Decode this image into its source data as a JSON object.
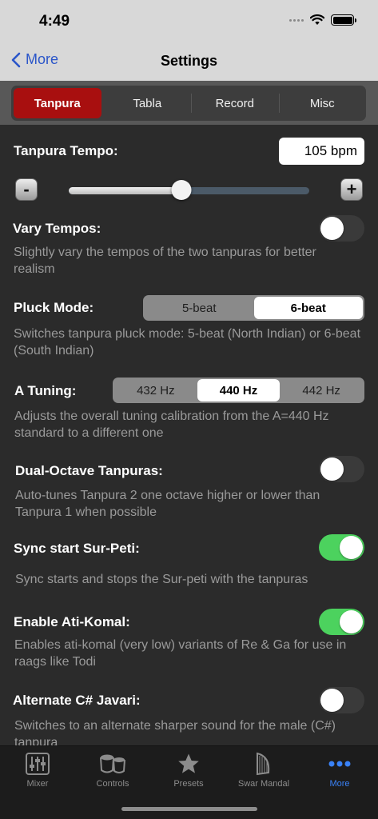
{
  "status": {
    "time": "4:49"
  },
  "nav": {
    "back_label": "More",
    "title": "Settings"
  },
  "tabs": [
    {
      "label": "Tanpura",
      "active": true
    },
    {
      "label": "Tabla",
      "active": false
    },
    {
      "label": "Record",
      "active": false
    },
    {
      "label": "Misc",
      "active": false
    }
  ],
  "tempo": {
    "label": "Tanpura Tempo:",
    "value": "105 bpm",
    "minus": "-",
    "plus": "+",
    "slider_fraction": 0.47
  },
  "vary_tempos": {
    "label": "Vary Tempos:",
    "on": false,
    "desc": "Slightly vary the tempos of the two tanpuras for better realism"
  },
  "pluck_mode": {
    "label": "Pluck Mode:",
    "options": [
      "5-beat",
      "6-beat"
    ],
    "selected": "6-beat",
    "desc": "Switches tanpura pluck mode: 5-beat (North Indian) or 6-beat (South Indian)"
  },
  "a_tuning": {
    "label": "A Tuning:",
    "options": [
      "432 Hz",
      "440 Hz",
      "442 Hz"
    ],
    "selected": "440 Hz",
    "desc": "Adjusts the overall tuning calibration from the A=440 Hz standard to a different one"
  },
  "dual_octave": {
    "label": "Dual-Octave Tanpuras:",
    "on": false,
    "desc": "Auto-tunes Tanpura 2 one octave higher or lower than Tanpura 1 when possible"
  },
  "sync_start": {
    "label": "Sync start Sur-Peti:",
    "on": true,
    "desc": "Sync starts and stops the Sur-peti with the tanpuras"
  },
  "ati_komal": {
    "label": "Enable Ati-Komal:",
    "on": true,
    "desc": "Enables ati-komal (very low) variants of Re & Ga for use in raags like Todi"
  },
  "alt_javari": {
    "label": "Alternate C# Javari:",
    "on": false,
    "desc": "Switches to an alternate sharper sound for the male (C#) tanpura"
  },
  "tabbar": [
    {
      "label": "Mixer",
      "icon": "mixer-icon",
      "active": false
    },
    {
      "label": "Controls",
      "icon": "drums-icon",
      "active": false
    },
    {
      "label": "Presets",
      "icon": "star-icon",
      "active": false
    },
    {
      "label": "Swar Mandal",
      "icon": "harp-icon",
      "active": false
    },
    {
      "label": "More",
      "icon": "more-dots-icon",
      "active": true
    }
  ],
  "colors": {
    "accent_red": "#a80f0f",
    "toggle_on": "#4cd25e",
    "link_blue": "#2a55c9",
    "tab_active_blue": "#3a82f7"
  }
}
